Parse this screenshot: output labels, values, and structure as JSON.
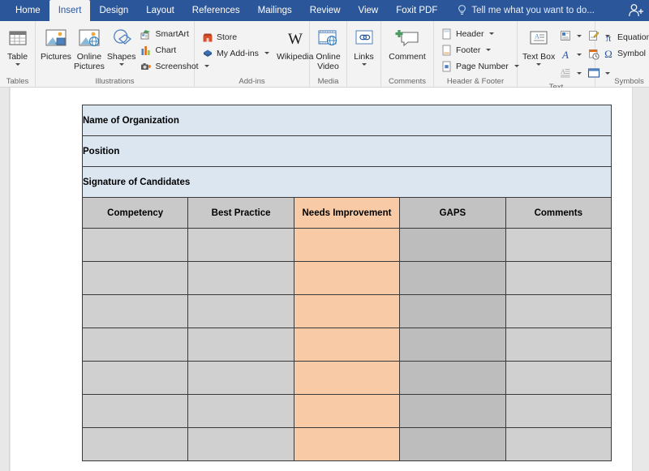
{
  "ribbon": {
    "tabs": [
      {
        "label": "Home",
        "active": false
      },
      {
        "label": "Insert",
        "active": true
      },
      {
        "label": "Design",
        "active": false
      },
      {
        "label": "Layout",
        "active": false
      },
      {
        "label": "References",
        "active": false
      },
      {
        "label": "Mailings",
        "active": false
      },
      {
        "label": "Review",
        "active": false
      },
      {
        "label": "View",
        "active": false
      },
      {
        "label": "Foxit PDF",
        "active": false
      }
    ],
    "tell_me": "Tell me what you want to do...",
    "account_icon": "person-add-icon",
    "groups": [
      {
        "name": "Tables",
        "label": "Tables",
        "items": [
          {
            "label": "Table",
            "icon": "table-icon"
          }
        ]
      },
      {
        "name": "Illustrations",
        "label": "Illustrations",
        "items": [
          {
            "label": "Pictures",
            "icon": "pictures-icon"
          },
          {
            "label": "Online Pictures",
            "icon": "online-pictures-icon"
          },
          {
            "label": "Shapes",
            "icon": "shapes-icon"
          },
          {
            "label": "SmartArt",
            "icon": "smartart-icon"
          },
          {
            "label": "Chart",
            "icon": "chart-icon"
          },
          {
            "label": "Screenshot",
            "icon": "screenshot-icon"
          }
        ]
      },
      {
        "name": "Add-ins",
        "label": "Add-ins",
        "items": [
          {
            "label": "Store",
            "icon": "store-icon"
          },
          {
            "label": "My Add-ins",
            "icon": "my-addins-icon"
          },
          {
            "label": "Wikipedia",
            "icon": "wikipedia-icon"
          }
        ]
      },
      {
        "name": "Media",
        "label": "Media",
        "items": [
          {
            "label": "Online Video",
            "icon": "online-video-icon"
          }
        ]
      },
      {
        "name": "Links",
        "label": "",
        "items": [
          {
            "label": "Links",
            "icon": "links-icon"
          }
        ]
      },
      {
        "name": "Comments",
        "label": "Comments",
        "items": [
          {
            "label": "Comment",
            "icon": "comment-icon"
          }
        ]
      },
      {
        "name": "Header & Footer",
        "label": "Header & Footer",
        "items": [
          {
            "label": "Header",
            "icon": "header-icon"
          },
          {
            "label": "Footer",
            "icon": "footer-icon"
          },
          {
            "label": "Page Number",
            "icon": "page-number-icon"
          }
        ]
      },
      {
        "name": "Text",
        "label": "Text",
        "items": [
          {
            "label": "Text Box",
            "icon": "text-box-icon"
          },
          {
            "label": "",
            "icon": "quick-parts-icon"
          },
          {
            "label": "",
            "icon": "wordart-icon"
          },
          {
            "label": "",
            "icon": "drop-cap-icon"
          },
          {
            "label": "",
            "icon": "signature-line-icon"
          },
          {
            "label": "",
            "icon": "date-time-icon"
          },
          {
            "label": "",
            "icon": "object-icon"
          }
        ]
      },
      {
        "name": "Symbols",
        "label": "Symbols",
        "items": [
          {
            "label": "Equation",
            "icon": "equation-icon"
          },
          {
            "label": "Symbol",
            "icon": "symbol-icon"
          }
        ]
      }
    ]
  },
  "document": {
    "table": {
      "info_rows": [
        "Name of Organization",
        "Position",
        "Signature of  Candidates"
      ],
      "columns": [
        "Competency",
        "Best Practice",
        "Needs Improvement",
        "GAPS",
        "Comments"
      ],
      "body_row_count": 7,
      "body_rows": [
        [
          "",
          "",
          "",
          "",
          ""
        ],
        [
          "",
          "",
          "",
          "",
          ""
        ],
        [
          "",
          "",
          "",
          "",
          ""
        ],
        [
          "",
          "",
          "",
          "",
          ""
        ],
        [
          "",
          "",
          "",
          "",
          ""
        ],
        [
          "",
          "",
          "",
          "",
          ""
        ],
        [
          "",
          "",
          "",
          "",
          ""
        ]
      ],
      "colors": {
        "info_row_fill": "#dce6f1",
        "header_fill": "#c9c9c9",
        "header_gaps_fill": "#c2c2c2",
        "header_highlight_fill": "#f8cba6",
        "body_fill": "#d0d0d0",
        "body_gaps_fill": "#bdbdbd",
        "body_highlight_fill": "#f8cba6",
        "border": "#3a3a3a"
      }
    }
  },
  "theme": {
    "ribbon_blue": "#2b579a",
    "ribbon_surface": "#f3f3f3"
  }
}
